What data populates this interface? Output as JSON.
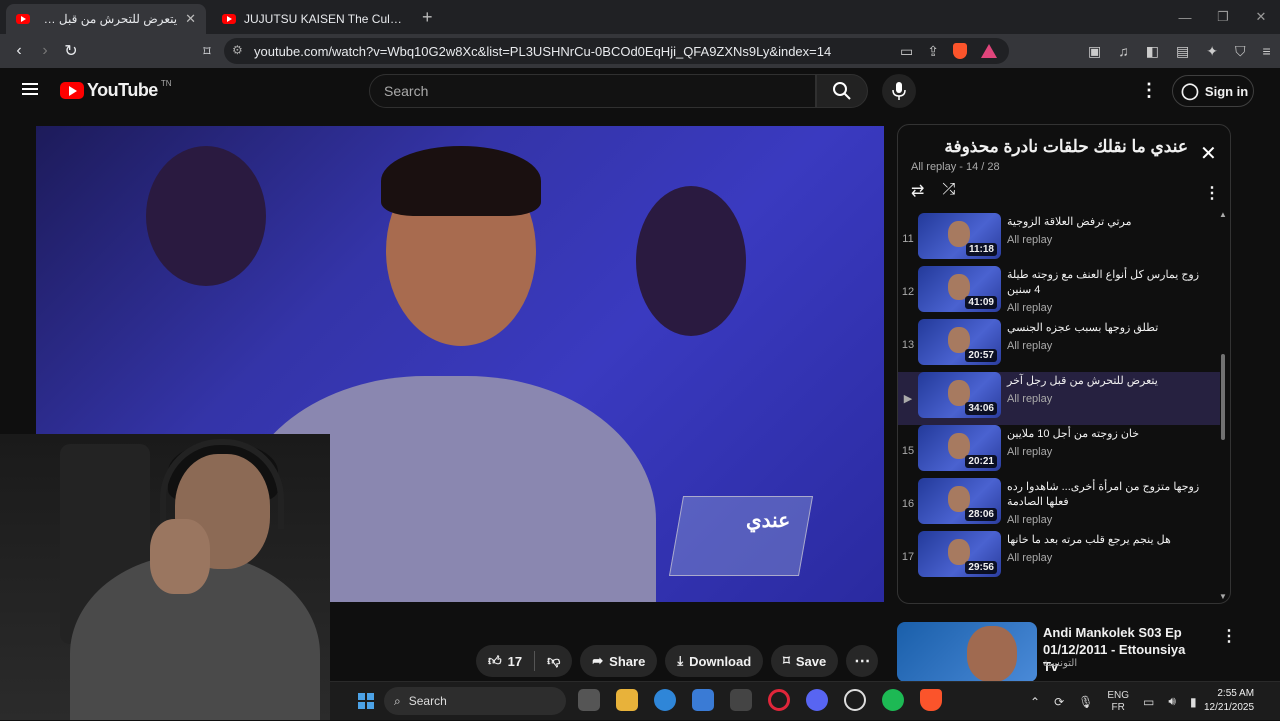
{
  "browser": {
    "tabs": [
      {
        "label": "يتعرض للتحرش من قبل رجل آخر -",
        "active": true
      },
      {
        "label": "JUJUTSU KAISEN The Culling Game |",
        "active": false
      }
    ],
    "url": "youtube.com/watch?v=Wbq10G2w8Xc&list=PL3USHNrCu-0BCOd0EqHji_QFA9ZXNs9Ly&index=14",
    "brave_badge": "1"
  },
  "header": {
    "logo_text": "YouTube",
    "logo_sup": "TN",
    "search_placeholder": "Search",
    "signin_label": "Sign in"
  },
  "video": {
    "watermark": "عندي"
  },
  "actions": {
    "like_count": "17",
    "share_label": "Share",
    "download_label": "Download",
    "save_label": "Save"
  },
  "playlist": {
    "title": "عندي ما نقلك حلقات  نادرة  محذوفة",
    "subtitle": "All replay - 14 / 28",
    "items": [
      {
        "index": "11",
        "title": "مرتي ترفض العلاقة الزوجية",
        "channel": "All replay",
        "duration": "11:18",
        "active": false
      },
      {
        "index": "12",
        "title": "زوج يمارس كل أنواع العنف مع زوجته طيلة 4 سنين",
        "channel": "All replay",
        "duration": "41:09",
        "active": false
      },
      {
        "index": "13",
        "title": "تطلق زوجها بسبب عجزه الجنسي",
        "channel": "All replay",
        "duration": "20:57",
        "active": false
      },
      {
        "index": "▶",
        "title": "يتعرض للتحرش من قبل رجل آخر",
        "channel": "All replay",
        "duration": "34:06",
        "active": true
      },
      {
        "index": "15",
        "title": "خان زوجته من أجل 10 ملايين",
        "channel": "All replay",
        "duration": "20:21",
        "active": false
      },
      {
        "index": "16",
        "title": "زوجها متزوج من امرأة أخرى... شاهدوا رده فعلها الصادمة",
        "channel": "All replay",
        "duration": "28:06",
        "active": false
      },
      {
        "index": "17",
        "title": "هل ينجم يرجع قلب مرته بعد ما خانها",
        "channel": "All replay",
        "duration": "29:56",
        "active": false
      }
    ]
  },
  "recommendation": {
    "title": "Andi Mankolek S03 Ep 01/12/2011 - Ettounsiya Tv",
    "channel": "التونسية"
  },
  "taskbar": {
    "search_label": "Search",
    "lang_top": "ENG",
    "lang_bottom": "FR",
    "time": "2:55 AM",
    "date": "12/21/2025"
  }
}
